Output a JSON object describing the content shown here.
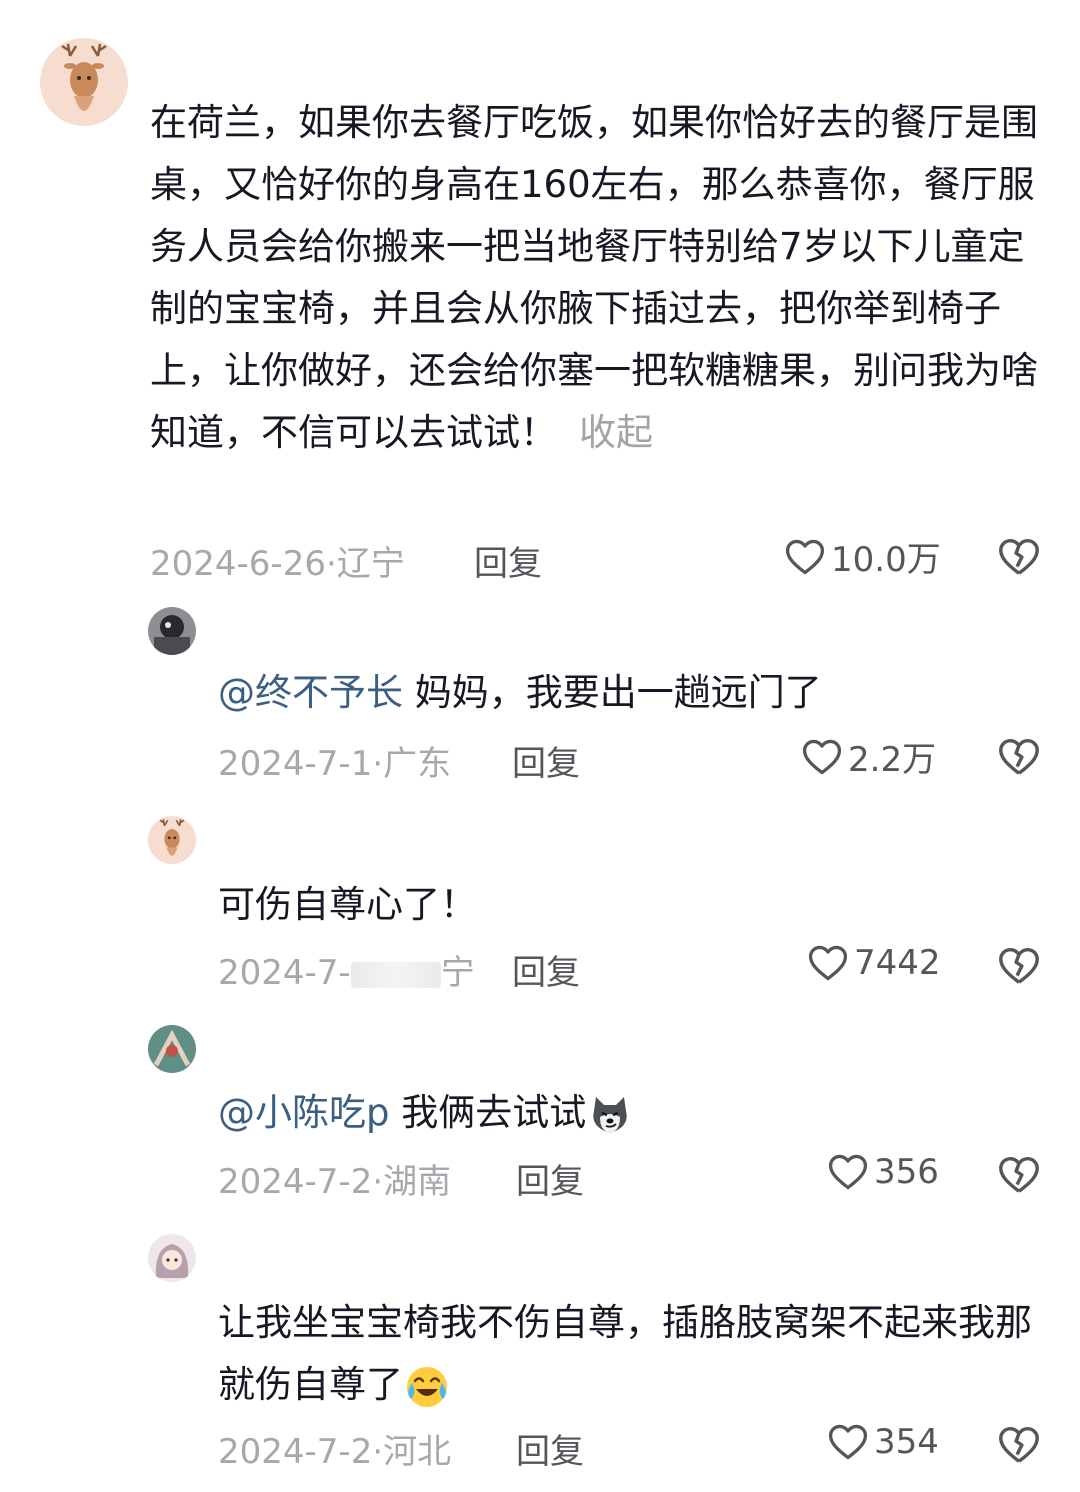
{
  "comments": [
    {
      "text": "在荷兰，如果你去餐厅吃饭，如果你恰好去的餐厅是围桌，又恰好你的身高在160左右，那么恭喜你，餐厅服务人员会给你搬来一把当地餐厅特别给7岁以下儿童定制的宝宝椅，并且会从你腋下插过去，把你举到椅子上，让你做好，还会给你塞一把软糖糖果，别问我为啥知道，不信可以去试试！",
      "collapse": "收起",
      "date": "2024-6-26",
      "location": "辽宁",
      "reply": "回复",
      "likes": "10.0万"
    },
    {
      "mention": "@终不予长",
      "text": "妈妈，我要出一趟远门了",
      "date": "2024-7-1",
      "location": "广东",
      "reply": "回复",
      "likes": "2.2万"
    },
    {
      "text": "可伤自尊心了！",
      "date": "2024-7-",
      "location": "宁",
      "reply": "回复",
      "likes": "7442"
    },
    {
      "mention": "@小陈吃p",
      "text": "我俩去试试",
      "date": "2024-7-2",
      "location": "湖南",
      "reply": "回复",
      "likes": "356"
    },
    {
      "text": "让我坐宝宝椅我不伤自尊，插胳肢窝架不起来我那就伤自尊了",
      "date": "2024-7-2",
      "location": "河北",
      "reply": "回复",
      "likes": "354"
    }
  ],
  "separator": "·",
  "icons": {
    "like": "heart-outline-icon",
    "dislike": "broken-heart-icon",
    "emoji_1": "husky-smirk-emoji",
    "emoji_2": "crying-laughing-emoji"
  }
}
